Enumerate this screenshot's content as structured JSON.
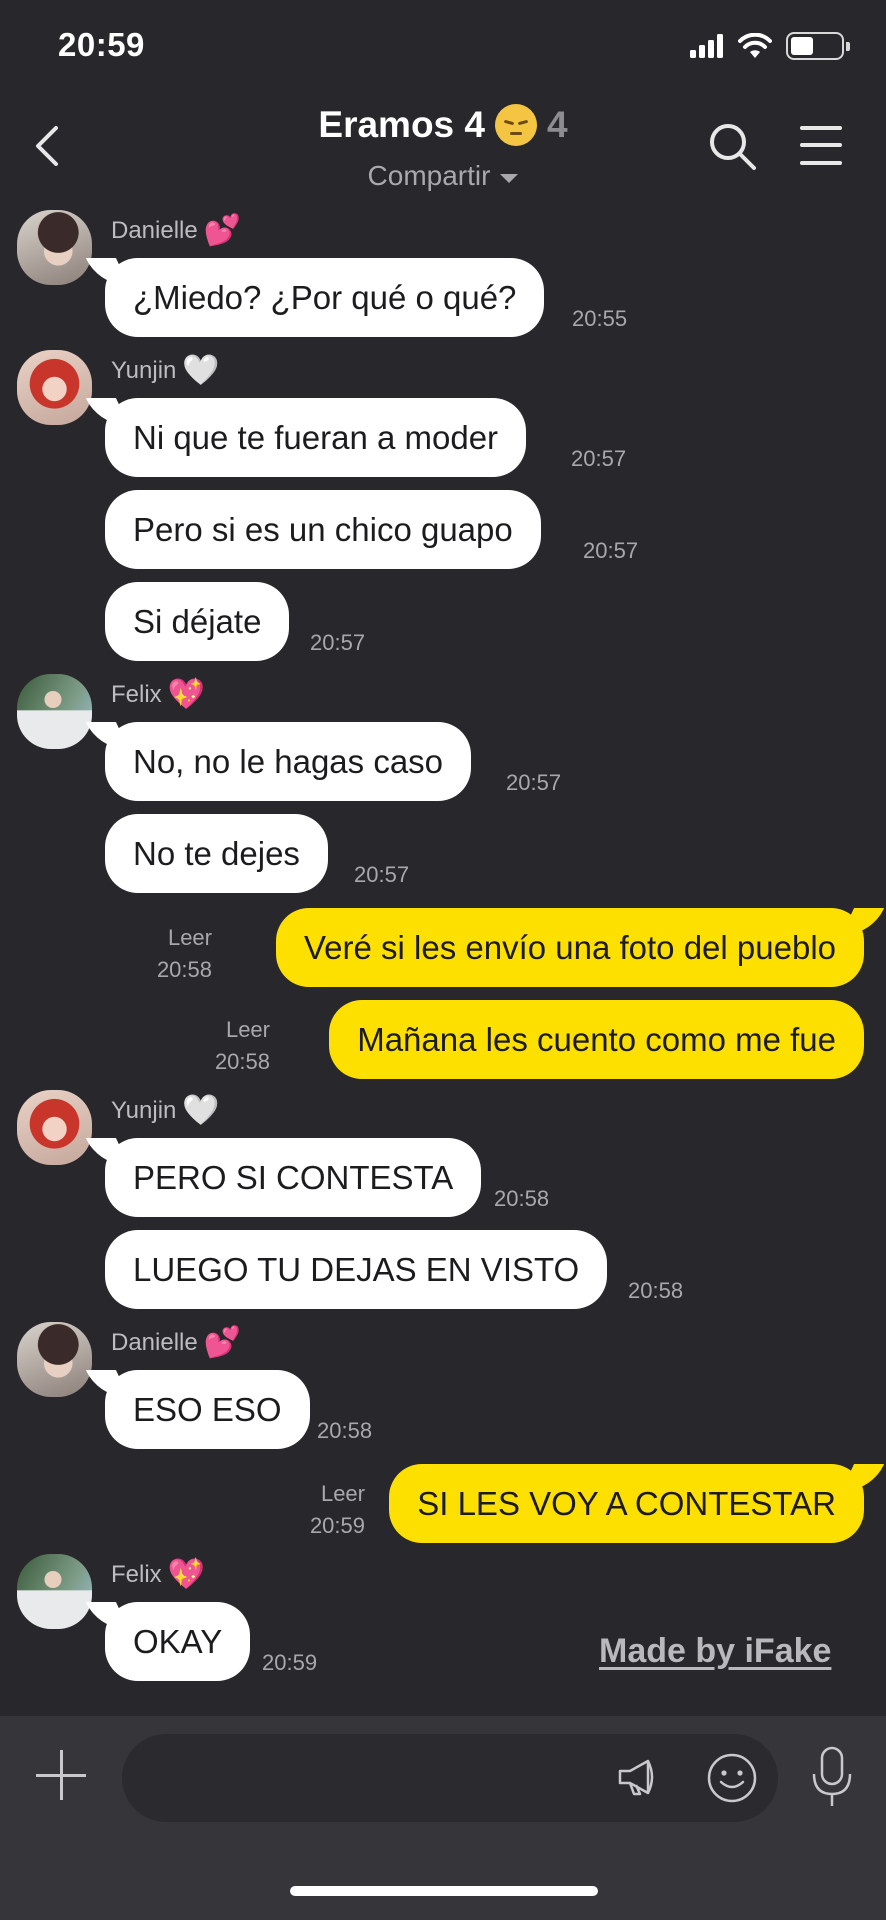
{
  "status_bar": {
    "time": "20:59"
  },
  "header": {
    "title": "Eramos 4",
    "member_count": "4",
    "subtitle": "Compartir"
  },
  "senders": {
    "danielle": "Danielle",
    "yunjin": "Yunjin",
    "felix": "Felix"
  },
  "messages": [
    {
      "text": "¿Miedo? ¿Por qué o qué?",
      "time": "20:55"
    },
    {
      "text": "Ni que te fueran a moder",
      "time": "20:57"
    },
    {
      "text": "Pero si es un chico guapo",
      "time": "20:57"
    },
    {
      "text": "Si déjate",
      "time": "20:57"
    },
    {
      "text": "No, no le hagas caso",
      "time": "20:57"
    },
    {
      "text": "No te dejes",
      "time": "20:57"
    },
    {
      "text": "Veré si les envío una foto del pueblo",
      "time": "20:58",
      "status": "Leer"
    },
    {
      "text": "Mañana les cuento como me fue",
      "time": "20:58",
      "status": "Leer"
    },
    {
      "text": "PERO SI CONTESTA",
      "time": "20:58"
    },
    {
      "text": "LUEGO TU DEJAS EN VISTO",
      "time": "20:58"
    },
    {
      "text": "ESO ESO",
      "time": "20:58"
    },
    {
      "text": "SI LES VOY A CONTESTAR",
      "time": "20:59",
      "status": "Leer"
    },
    {
      "text": "OKAY",
      "time": "20:59"
    }
  ],
  "watermark": "Made by iFake",
  "composer": {
    "placeholder": ""
  },
  "colors": {
    "background": "#28272c",
    "incoming_bubble": "#ffffff",
    "outgoing_bubble": "#fde000",
    "input_bar": "#36353a"
  },
  "icons": [
    "back-chevron-icon",
    "search-icon",
    "menu-icon",
    "plus-icon",
    "megaphone-icon",
    "emoji-icon",
    "microphone-icon",
    "signal-icon",
    "wifi-icon",
    "battery-icon"
  ]
}
